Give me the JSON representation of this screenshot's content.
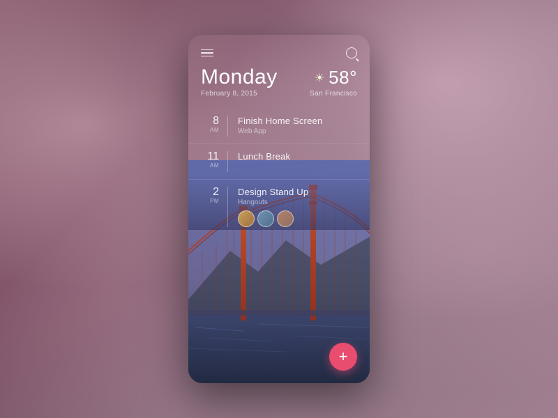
{
  "background": {
    "color": "#6b4055"
  },
  "header": {
    "menu_label": "menu",
    "search_label": "search"
  },
  "date": {
    "day_name": "Monday",
    "date_sub": "February 8, 2015"
  },
  "weather": {
    "temperature": "58°",
    "location": "San Francisco",
    "icon": "☀"
  },
  "events": [
    {
      "hour": "8",
      "period": "AM",
      "title": "Finish Home Screen",
      "subtitle": "Web App",
      "avatars": []
    },
    {
      "hour": "11",
      "period": "AM",
      "title": "Lunch Break",
      "subtitle": "",
      "avatars": []
    },
    {
      "hour": "2",
      "period": "PM",
      "title": "Design Stand Up",
      "subtitle": "Hangouts",
      "avatars": [
        "A",
        "B",
        "C"
      ]
    }
  ],
  "fab": {
    "label": "+"
  }
}
